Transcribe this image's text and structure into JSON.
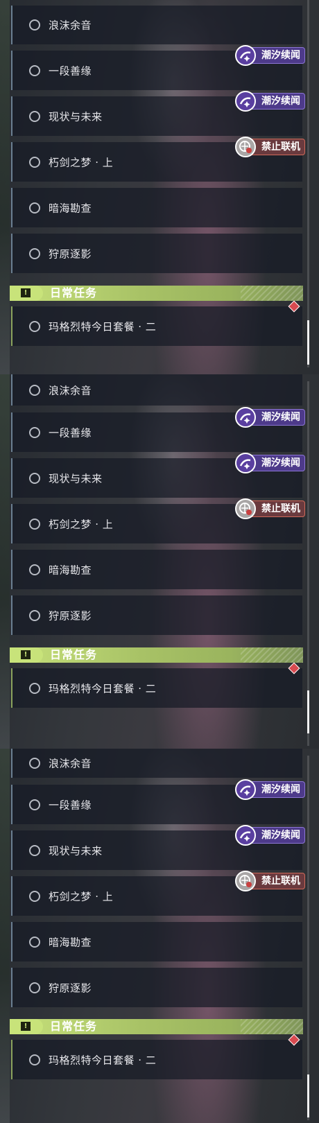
{
  "quest_list": {
    "panels": [
      {
        "quests": [
          {
            "title": "浪沫余音",
            "tag": null
          },
          {
            "title": "一段善缘",
            "tag": "潮汐续闻"
          },
          {
            "title": "现状与未来",
            "tag": "潮汐续闻"
          },
          {
            "title": "朽剑之梦 · 上",
            "tag": "禁止联机"
          },
          {
            "title": "暗海勘查",
            "tag": null
          },
          {
            "title": "狩原逐影",
            "tag": null
          }
        ],
        "section_title": "日常任务",
        "daily": {
          "title": "玛格烈特今日套餐 · 二"
        }
      },
      {
        "quests": [
          {
            "title": "浪沫余音",
            "tag": null
          },
          {
            "title": "一段善缘",
            "tag": "潮汐续闻"
          },
          {
            "title": "现状与未来",
            "tag": "潮汐续闻"
          },
          {
            "title": "朽剑之梦 · 上",
            "tag": "禁止联机"
          },
          {
            "title": "暗海勘查",
            "tag": null
          },
          {
            "title": "狩原逐影",
            "tag": null
          }
        ],
        "section_title": "日常任务",
        "daily": {
          "title": "玛格烈特今日套餐 · 二"
        }
      },
      {
        "quests": [
          {
            "title": "浪沫余音",
            "tag": null
          },
          {
            "title": "一段善缘",
            "tag": "潮汐续闻"
          },
          {
            "title": "现状与未来",
            "tag": "潮汐续闻"
          },
          {
            "title": "朽剑之梦 · 上",
            "tag": "禁止联机"
          },
          {
            "title": "暗海勘查",
            "tag": null
          },
          {
            "title": "狩原逐影",
            "tag": null
          }
        ],
        "section_title": "日常任务",
        "daily": {
          "title": "玛格烈特今日套餐 · 二"
        }
      }
    ],
    "icons": {
      "tag_tide": "wave-star-icon",
      "tag_no_coop": "no-multiplayer-icon",
      "section": "exclamation-icon",
      "daily_marker": "red-diamond-icon",
      "quest_status": "circle-icon"
    },
    "colors": {
      "row_bg": "#161a26",
      "section_bg": "#c6e07a",
      "tag_purple": "#4d3a8a",
      "tag_red": "#6a3a3e",
      "diamond": "#d84a50"
    }
  }
}
